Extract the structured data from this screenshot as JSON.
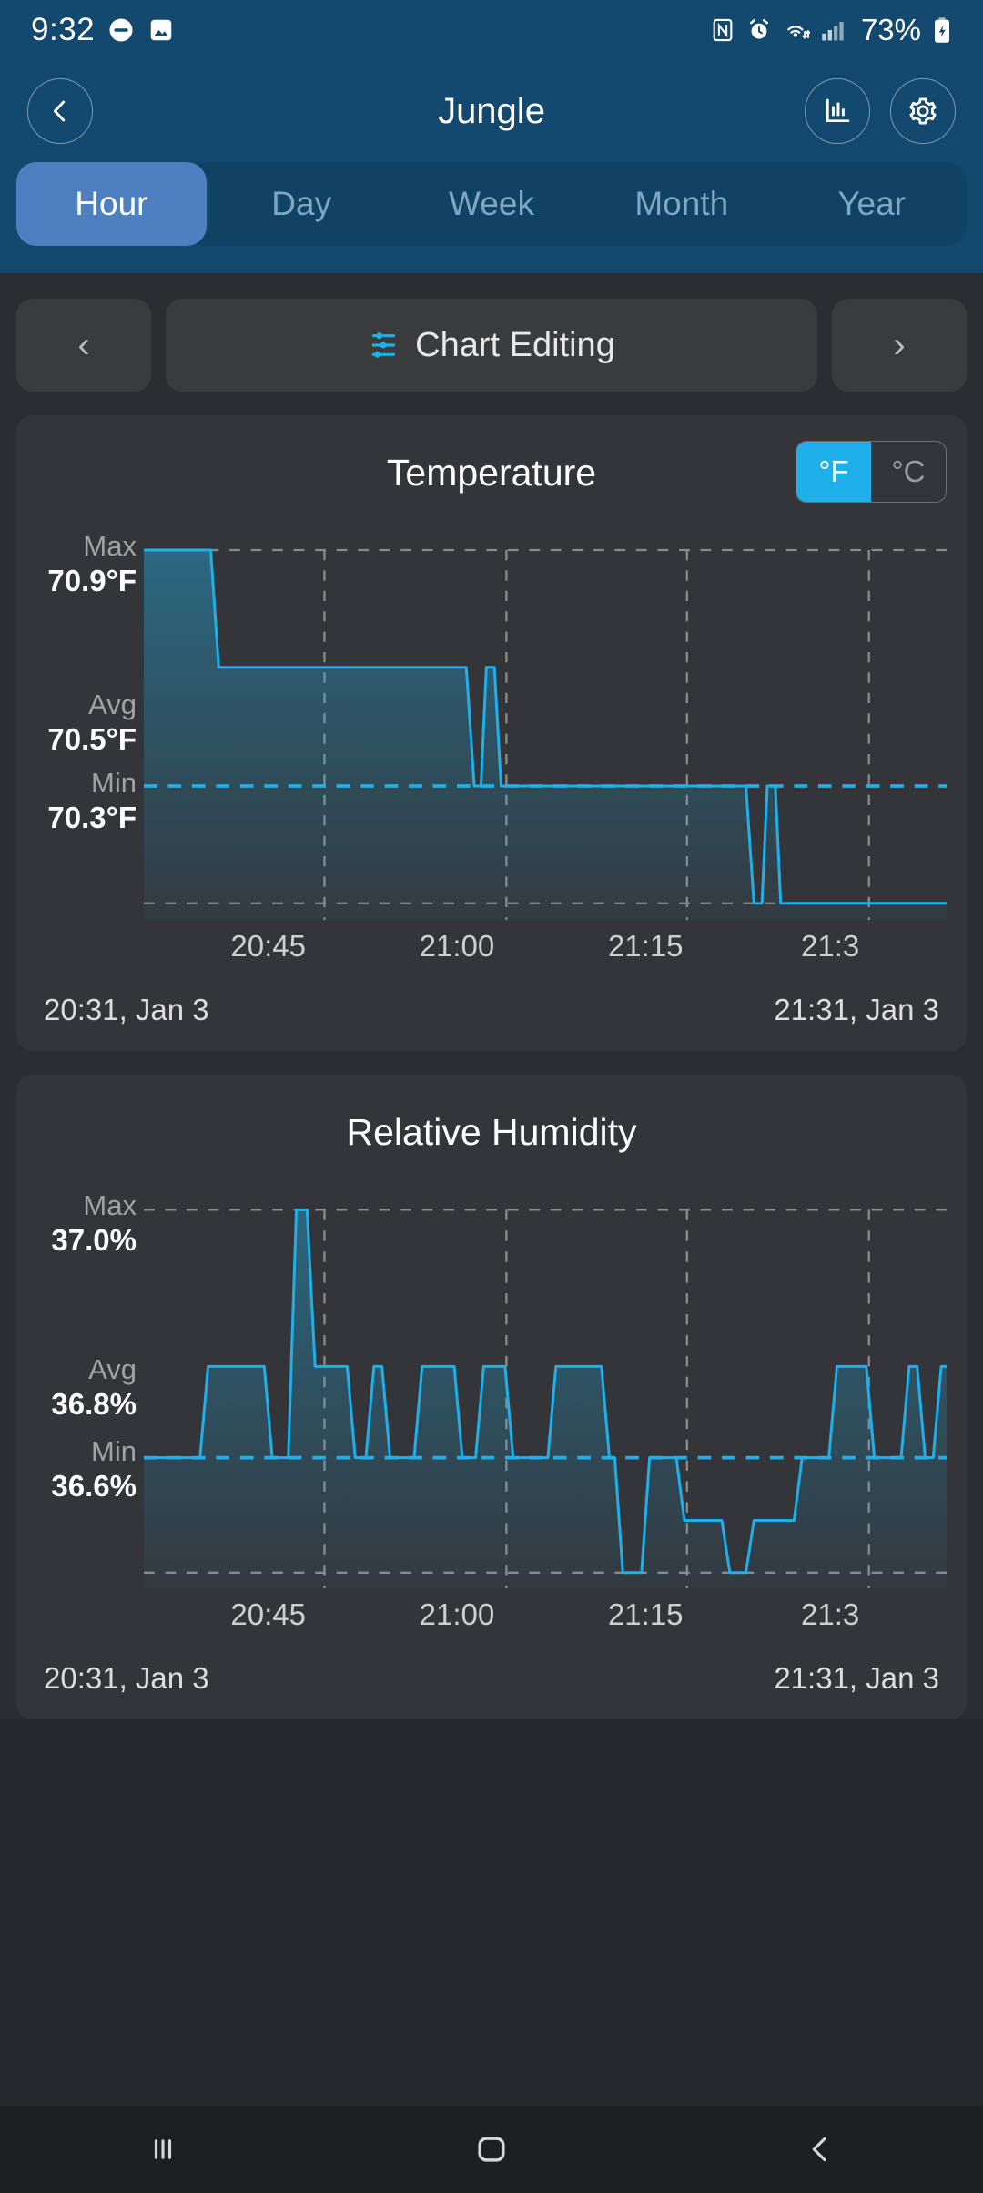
{
  "status_bar": {
    "time": "9:32",
    "battery_percent": "73%",
    "icons": [
      "do-not-disturb-icon",
      "photo-icon",
      "nfc-icon",
      "alarm-icon",
      "wifi-icon",
      "signal-icon",
      "battery-charging-icon"
    ]
  },
  "header": {
    "title": "Jungle",
    "back_icon": "chevron-left-icon",
    "stats_icon": "bar-chart-icon",
    "settings_icon": "gear-icon"
  },
  "period_tabs": {
    "active": "Hour",
    "items": [
      "Hour",
      "Day",
      "Week",
      "Month",
      "Year"
    ]
  },
  "chart_nav": {
    "prev_label": "‹",
    "next_label": "›",
    "edit_label": "Chart Editing",
    "edit_icon": "tune-sliders-icon",
    "accent": "#1fafea"
  },
  "colors": {
    "accent": "#1fafea",
    "header_bg": "#13496e",
    "tab_active": "#4e7fc0",
    "card_bg": "#333538",
    "page_bg": "#2b2e31"
  },
  "cards": [
    {
      "title": "Temperature",
      "unit_toggle": {
        "options": [
          "°F",
          "°C"
        ],
        "active": "°F"
      },
      "stats": {
        "max_key": "Max",
        "max_val": "70.9°F",
        "avg_key": "Avg",
        "avg_val": "70.5°F",
        "min_key": "Min",
        "min_val": "70.3°F"
      },
      "x_ticks": [
        "20:45",
        "21:00",
        "21:15",
        "21:3"
      ],
      "range_start": "20:31, Jan 3",
      "range_end": "21:31, Jan 3"
    },
    {
      "title": "Relative Humidity",
      "stats": {
        "max_key": "Max",
        "max_val": "37.0%",
        "avg_key": "Avg",
        "avg_val": "36.8%",
        "min_key": "Min",
        "min_val": "36.6%"
      },
      "x_ticks": [
        "20:45",
        "21:00",
        "21:15",
        "21:3"
      ],
      "range_start": "20:31, Jan 3",
      "range_end": "21:31, Jan 3"
    }
  ],
  "chart_data": [
    {
      "type": "line",
      "title": "Temperature",
      "ylabel": "°F",
      "xlabel": "",
      "ylim": [
        70.3,
        70.9
      ],
      "yticks": [
        70.3,
        70.5,
        70.9
      ],
      "ytick_labels": [
        "Min 70.3°F",
        "Avg 70.5°F",
        "Max 70.9°F"
      ],
      "grid": true,
      "avg_line": 70.5,
      "x_range": [
        "20:31",
        "21:31"
      ],
      "xticks": [
        "20:45",
        "21:00",
        "21:15",
        "21:3"
      ],
      "x": [
        0,
        5,
        6,
        7,
        26,
        27,
        28,
        29,
        30,
        31,
        32,
        44,
        45,
        46,
        47,
        48,
        49,
        60
      ],
      "y": [
        70.9,
        70.9,
        70.88,
        70.7,
        70.7,
        70.68,
        70.5,
        70.52,
        70.7,
        70.7,
        70.5,
        70.5,
        70.49,
        70.3,
        70.32,
        70.5,
        70.3,
        70.3
      ]
    },
    {
      "type": "line",
      "title": "Relative Humidity",
      "ylabel": "%",
      "xlabel": "",
      "ylim": [
        36.6,
        37.0
      ],
      "yticks": [
        36.6,
        36.8,
        37.0
      ],
      "ytick_labels": [
        "Min 36.6%",
        "Avg 36.8%",
        "Max 37.0%"
      ],
      "grid": true,
      "avg_line": 36.8,
      "x_range": [
        "20:31",
        "21:31"
      ],
      "xticks": [
        "20:45",
        "21:00",
        "21:15",
        "21:3"
      ],
      "x": [
        0,
        4,
        5,
        7,
        9,
        10,
        11,
        12,
        13,
        14,
        15,
        16,
        17,
        18,
        19,
        20,
        21,
        22,
        23,
        24,
        25,
        26,
        27,
        28,
        29,
        30,
        31,
        32,
        33,
        34,
        35,
        36,
        37,
        38,
        39,
        40,
        41,
        42,
        43,
        44,
        45,
        46,
        47,
        48,
        49,
        50,
        51,
        52,
        53,
        54,
        55,
        56,
        57,
        58,
        59,
        60
      ],
      "y": [
        36.8,
        36.8,
        36.9,
        36.9,
        36.8,
        37.0,
        36.88,
        36.88,
        36.8,
        36.9,
        36.8,
        36.8,
        36.9,
        36.9,
        36.8,
        36.9,
        36.8,
        36.8,
        36.9,
        36.9,
        36.8,
        36.7,
        36.7,
        36.8,
        36.8,
        36.7,
        36.7,
        36.6,
        36.6,
        36.7,
        36.7,
        36.6,
        36.6,
        36.7,
        36.7,
        36.8,
        36.8,
        36.7,
        36.7,
        36.8,
        36.7,
        36.7,
        36.65,
        36.65,
        36.6,
        36.7,
        36.6,
        36.6,
        36.7,
        36.6,
        36.6,
        36.75,
        36.6,
        36.6,
        36.7,
        36.75
      ]
    }
  ],
  "bottom_nav": {
    "recents_icon": "recents-icon",
    "home_icon": "home-icon",
    "back_icon": "back-icon"
  }
}
